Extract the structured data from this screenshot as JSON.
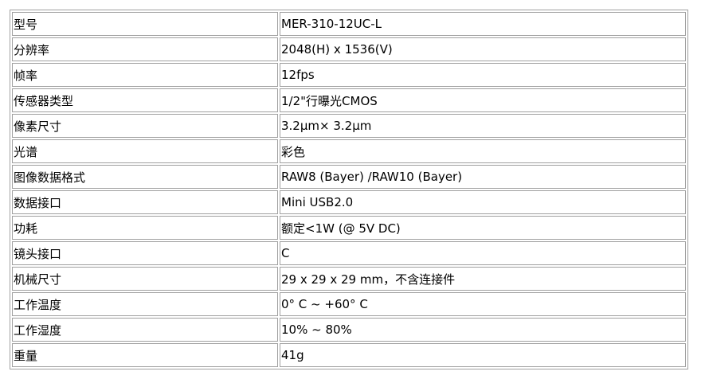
{
  "spec_table": {
    "rows": [
      {
        "label": "型号",
        "value": "MER-310-12UC-L"
      },
      {
        "label": "分辨率",
        "value": "2048(H) x 1536(V)"
      },
      {
        "label": "帧率",
        "value": "12fps"
      },
      {
        "label": "传感器类型",
        "value": "1/2\"行曝光CMOS"
      },
      {
        "label": "像素尺寸",
        "value": "3.2μm× 3.2μm"
      },
      {
        "label": "光谱",
        "value": "彩色"
      },
      {
        "label": "图像数据格式",
        "value": "RAW8 (Bayer) /RAW10 (Bayer)"
      },
      {
        "label": "数据接口",
        "value": "Mini USB2.0"
      },
      {
        "label": "功耗",
        "value": "额定<1W (@ 5V DC)"
      },
      {
        "label": "镜头接口",
        "value": "C"
      },
      {
        "label": "机械尺寸",
        "value": "29 x 29 x 29 mm，不含连接件"
      },
      {
        "label": "工作温度",
        "value": "0° C ~ +60° C"
      },
      {
        "label": "工作湿度",
        "value": "10% ~ 80%"
      },
      {
        "label": "重量",
        "value": "41g"
      }
    ]
  }
}
